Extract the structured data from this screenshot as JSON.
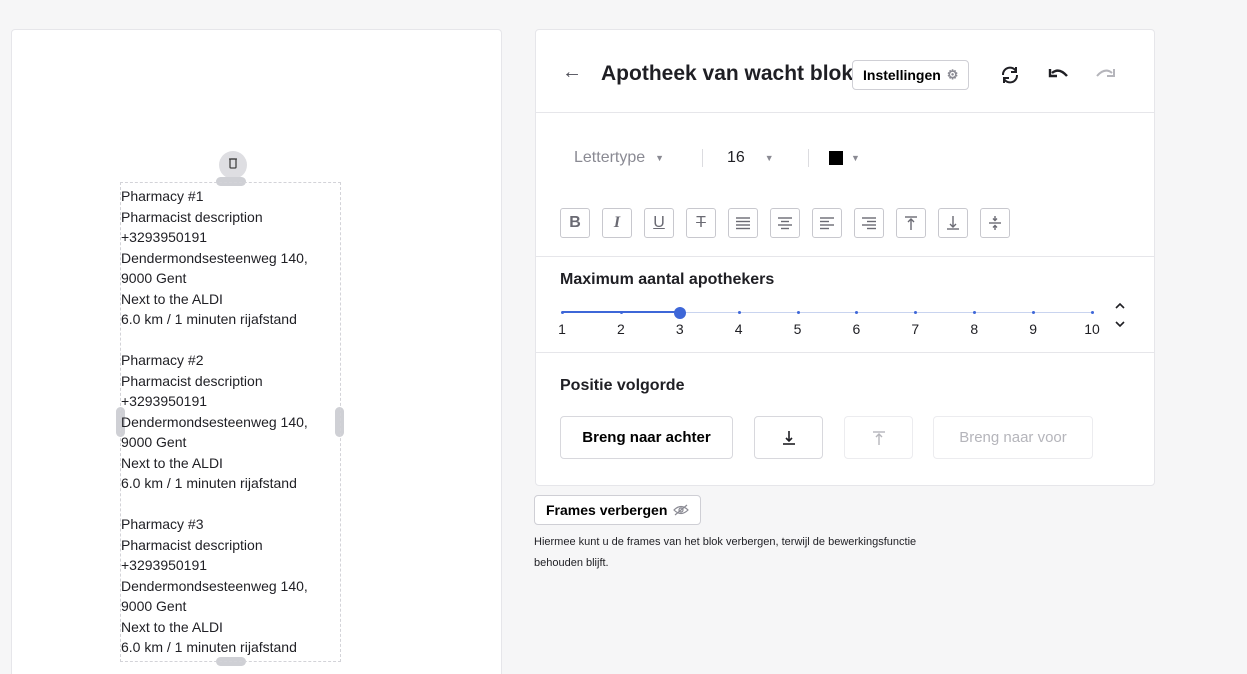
{
  "canvas": {
    "pharmacies": [
      {
        "name": "Pharmacy #1",
        "description": "Pharmacist description",
        "phone": "+3293950191",
        "street": "Dendermondsesteenweg 140,",
        "city": "9000 Gent",
        "note": "Next to the ALDI",
        "distance": "6.0 km / 1 minuten rijafstand"
      },
      {
        "name": "Pharmacy #2",
        "description": "Pharmacist description",
        "phone": "+3293950191",
        "street": "Dendermondsesteenweg 140,",
        "city": "9000 Gent",
        "note": "Next to the ALDI",
        "distance": "6.0 km / 1 minuten rijafstand"
      },
      {
        "name": "Pharmacy #3",
        "description": "Pharmacist description",
        "phone": "+3293950191",
        "street": "Dendermondsesteenweg 140,",
        "city": "9000 Gent",
        "note": "Next to the ALDI",
        "distance": "6.0 km / 1 minuten rijafstand"
      }
    ]
  },
  "header": {
    "title": "Apotheek van wacht blok",
    "settings_label": "Instellingen"
  },
  "typography": {
    "font_placeholder": "Lettertype",
    "font_size": "16",
    "text_color": "#000000"
  },
  "slider": {
    "label": "Maximum aantal apothekers",
    "min": 1,
    "max": 10,
    "value": 3,
    "ticks": [
      "1",
      "2",
      "3",
      "4",
      "5",
      "6",
      "7",
      "8",
      "9",
      "10"
    ],
    "accent_color": "#3e67d8"
  },
  "order": {
    "label": "Positie volgorde",
    "send_back_label": "Breng naar achter",
    "bring_front_label": "Breng naar voor"
  },
  "frames": {
    "button_label": "Frames verbergen",
    "hint": "Hiermee kunt u de frames van het blok verbergen, terwijl de bewerkingsfunctie behouden blijft."
  }
}
